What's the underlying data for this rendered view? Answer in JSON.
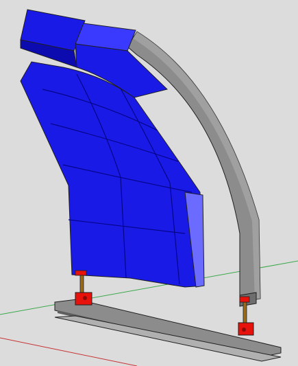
{
  "scene": {
    "subject": "curved-panel-array-on-arched-support",
    "colors": {
      "background": "#dcdcdc",
      "panel_fill": "#1a1ae6",
      "panel_dark": "#0b0bb0",
      "panel_light": "#3a3aff",
      "panel_grid_line": "#05058a",
      "panel_edge": "#6b6bff",
      "beam_fill": "#8c8c8c",
      "beam_dark": "#5e5e5e",
      "beam_light": "#b0b0b0",
      "mount_red": "#e8120c",
      "rod_brown": "#9a6a1c",
      "axis_green": "#3aa84a",
      "axis_red": "#c83232",
      "outline": "#1e1e1e"
    },
    "components": [
      "upper-panel-row-left",
      "upper-panel-row-right",
      "curved-panel-array",
      "arched-gray-beam",
      "base-i-beam",
      "front-red-mount",
      "rear-red-mount"
    ]
  }
}
